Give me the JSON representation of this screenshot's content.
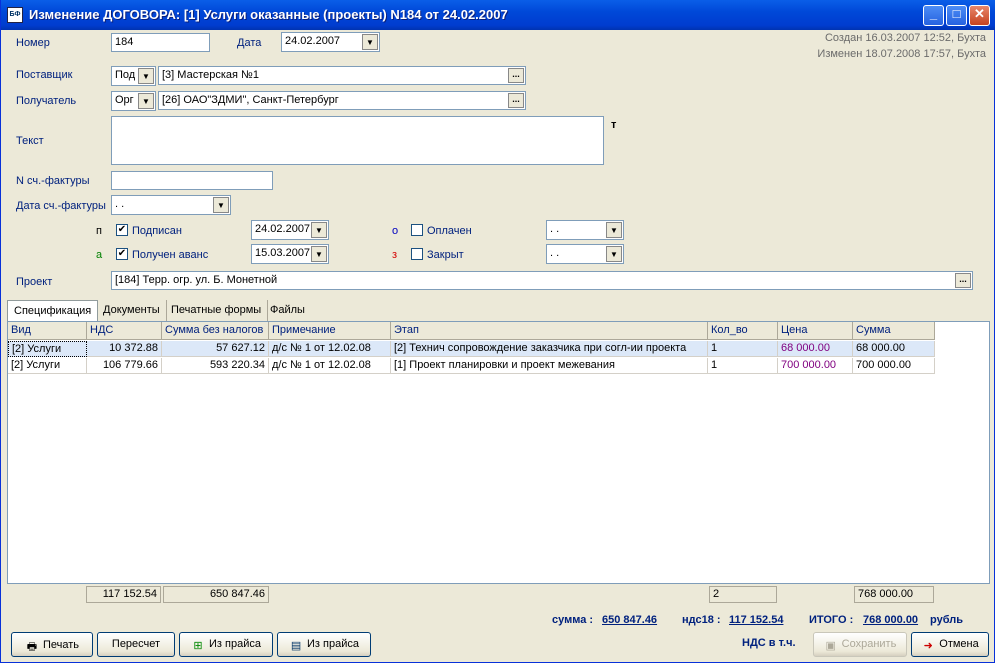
{
  "window": {
    "title": "Изменение ДОГОВОРА: [1]  Услуги оказанные (проекты) N184 от 24.02.2007"
  },
  "meta": {
    "created": "Создан 16.03.2007 12:52, Бухта",
    "modified": "Изменен 18.07.2008 17:57, Бухта"
  },
  "form": {
    "number_label": "Номер",
    "number_value": "184",
    "date_label": "Дата",
    "date_value": "24.02.2007",
    "supplier_label": "Поставщик",
    "supplier_kind": "Под",
    "supplier_value": "[3]  Мастерская №1",
    "recipient_label": "Получатель",
    "recipient_kind": "Орг",
    "recipient_value": "[26]  ОАО\"ЗДМИ\", Санкт-Петербург",
    "text_label": "Текст",
    "text_marker": "т",
    "invoice_no_label": "N сч.-фактуры",
    "invoice_no_value": "",
    "invoice_date_label": "Дата сч.-фактуры",
    "invoice_date_value": ". .",
    "signed_prefix": "п",
    "signed_label": "Подписан",
    "signed_checked": true,
    "signed_date": "24.02.2007",
    "advance_prefix": "а",
    "advance_label": "Получен аванс",
    "advance_checked": true,
    "advance_date": "15.03.2007",
    "paid_prefix": "о",
    "paid_label": "Оплачен",
    "paid_checked": false,
    "paid_date": ". .",
    "closed_prefix": "з",
    "closed_label": "Закрыт",
    "closed_checked": false,
    "closed_date": ". .",
    "project_label": "Проект",
    "project_value": "[184] Терр. огр. ул. Б. Монетной",
    "ellipsis": "..."
  },
  "tabs": [
    "Спецификация",
    "Документы",
    "Печатные формы",
    "Файлы"
  ],
  "grid": {
    "headers": [
      "Вид",
      "НДС",
      "Сумма без налогов",
      "Примечание",
      "Этап",
      "Кол_во",
      "Цена",
      "Сумма"
    ],
    "rows": [
      [
        "[2]  Услуги",
        "10 372.88",
        "57 627.12",
        "д/с № 1 от 12.02.08",
        "[2] Технич сопровождение заказчика при согл-ии проекта",
        "1",
        "68 000.00",
        "68 000.00"
      ],
      [
        "[2]  Услуги",
        "106 779.66",
        "593 220.34",
        "д/с № 1 от 12.02.08",
        "[1] Проект планировки и проект межевания",
        "1",
        "700 000.00",
        "700 000.00"
      ]
    ],
    "totals": {
      "nds": "117 152.54",
      "sum_no_tax": "650 847.46",
      "qty": "2",
      "sum": "768 000.00"
    }
  },
  "summary": {
    "sum_label": "сумма :",
    "sum_value": "650 847.46",
    "nds_label": "ндс18 :",
    "nds_value": "117 152.54",
    "total_label": "ИТОГО :",
    "total_value": "768 000.00",
    "total_unit": "рубль",
    "vat_note": "НДС в т.ч."
  },
  "buttons": {
    "print": "Печать",
    "recalc": "Пересчет",
    "from_price1": "Из прайса",
    "from_price2": "Из прайса",
    "save": "Сохранить",
    "cancel": "Отмена"
  },
  "colors": {
    "label": "#00217e",
    "price": "#800080",
    "selected_row": "#dce8f8",
    "prefix_green": "#008000",
    "prefix_red": "#d40000",
    "prefix_blue": "#0000c0"
  }
}
